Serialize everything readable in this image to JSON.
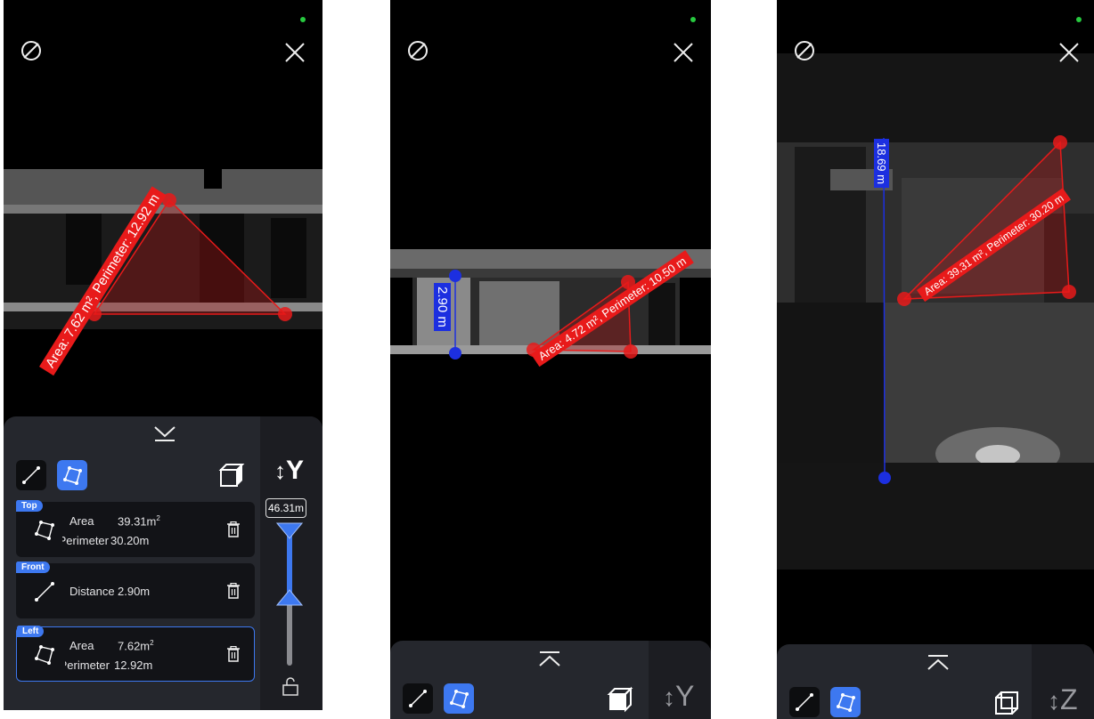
{
  "screens": [
    {
      "measure_label": "Area: 7.62 m², Perimeter: 12.92 m",
      "axis_label": "Y",
      "height_value": "46.31m",
      "measurements": [
        {
          "tag": "Top",
          "row1_label": "Area",
          "row1_value": "39.31m",
          "row1_unit_sup": "2",
          "row2_label": "Perimeter",
          "row2_value": "30.20m"
        },
        {
          "tag": "Front",
          "row1_label": "Distance",
          "row1_value": "2.90m"
        },
        {
          "tag": "Left",
          "row1_label": "Area",
          "row1_value": "7.62m",
          "row1_unit_sup": "2",
          "row2_label": "Perimeter",
          "row2_value": "12.92m"
        }
      ]
    },
    {
      "distance_label": "2.90 m",
      "measure_label": "Area: 4.72 m², Perimeter: 10.50 m",
      "axis_label": "Y"
    },
    {
      "distance_label": "18.69 m",
      "measure_label": "Area: 39.31 m², Perimeter: 30.20 m",
      "axis_label": "Z"
    }
  ],
  "icons": {
    "rotate": "rotate-icon",
    "close": "close-icon",
    "collapse": "chevron-down-icon",
    "expand": "chevron-up-icon",
    "line_tool": "line-tool-icon",
    "polygon_tool": "polygon-tool-icon",
    "cube": "cube-icon",
    "delete": "trash-icon",
    "lock": "unlock-icon"
  },
  "colors": {
    "accent": "#3d78f0",
    "measure_red": "#e81a1a",
    "measure_blue": "#1c2fe0",
    "status_dot": "#27c93f"
  }
}
